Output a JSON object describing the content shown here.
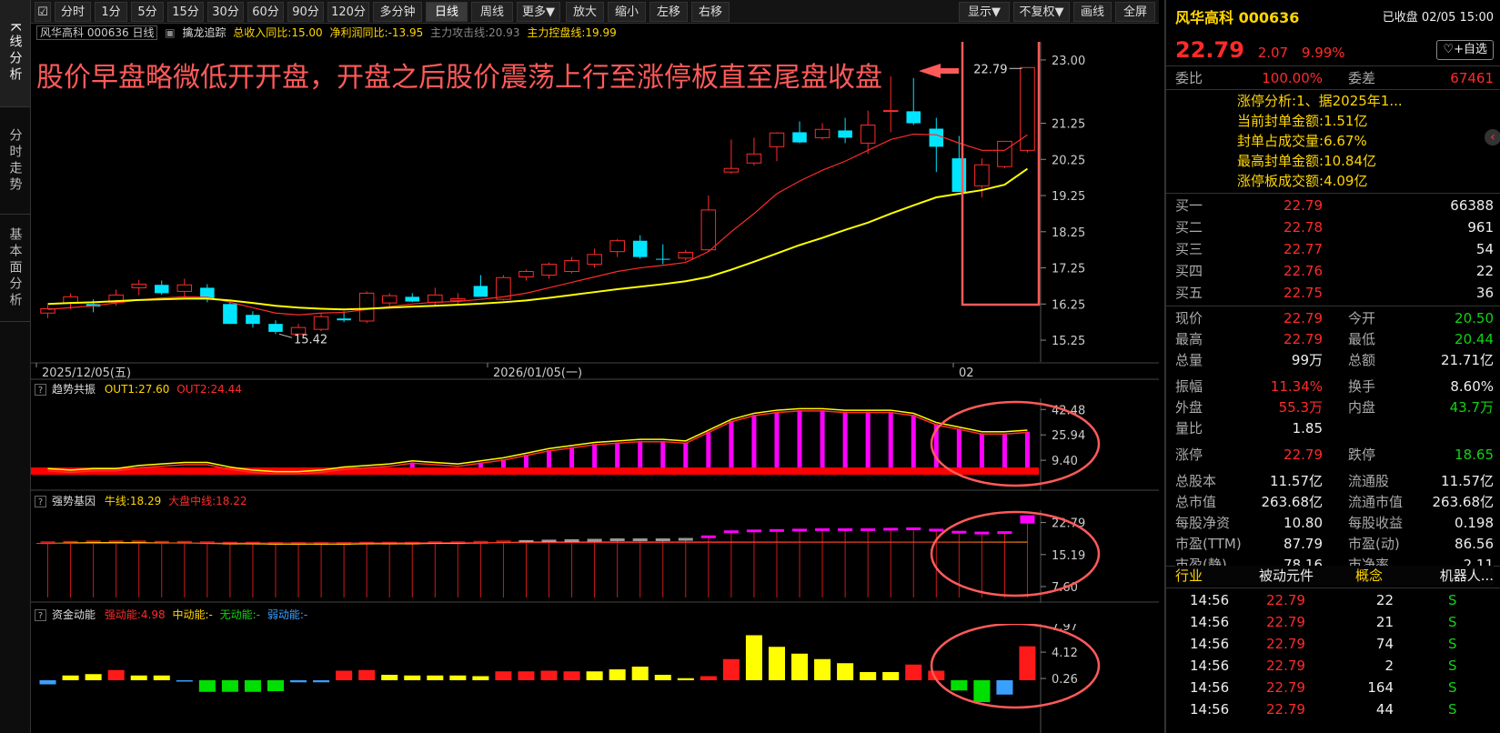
{
  "left_tabs": [
    "K线分析",
    "分时走势",
    "基本面分析"
  ],
  "toolbar": {
    "periods": [
      "分时",
      "1分",
      "5分",
      "15分",
      "30分",
      "60分",
      "90分",
      "120分",
      "多分钟",
      "日线",
      "周线",
      "更多▼"
    ],
    "active_period": "日线",
    "actions": [
      "放大",
      "缩小",
      "左移",
      "右移"
    ],
    "right": [
      "显示▼",
      "不复权▼",
      "画线",
      "全屏"
    ]
  },
  "indicator": {
    "name": "风华高科 000636 日线",
    "study": "擒龙追踪",
    "items": [
      {
        "text": "总收入同比:15.00",
        "color": "#ffd600"
      },
      {
        "text": "净利润同比:-13.95",
        "color": "#ffd600"
      },
      {
        "text": "主力攻击线:20.93",
        "color": "#888888"
      },
      {
        "text": "主力控盘线:19.99",
        "color": "#ffd600"
      }
    ]
  },
  "annotation": "股价早盘略微低开开盘，开盘之后股价震荡上行至涨停板直至尾盘收盘",
  "main_chart": {
    "y_ticks": [
      "23.00",
      "21.25",
      "20.25",
      "19.25",
      "18.25",
      "17.25",
      "16.25",
      "15.25"
    ],
    "x_labels": [
      "2025/12/05(五)",
      "2026/01/05(一)",
      "02"
    ],
    "low_label": "15.42",
    "high_label": "22.79"
  },
  "chart_data": [
    {
      "type": "candlestick",
      "title": "风华高科 000636 日线",
      "ylim": [
        15.0,
        23.3
      ],
      "ohlc": [
        [
          16.0,
          16.22,
          15.86,
          16.12
        ],
        [
          16.28,
          16.55,
          16.1,
          16.45
        ],
        [
          16.25,
          16.38,
          16.02,
          16.18
        ],
        [
          16.3,
          16.65,
          16.2,
          16.5
        ],
        [
          16.7,
          16.92,
          16.5,
          16.8
        ],
        [
          16.78,
          16.9,
          16.5,
          16.55
        ],
        [
          16.6,
          16.95,
          16.45,
          16.78
        ],
        [
          16.7,
          16.8,
          16.3,
          16.4
        ],
        [
          16.25,
          16.3,
          15.7,
          15.7
        ],
        [
          15.95,
          16.05,
          15.6,
          15.7
        ],
        [
          15.7,
          15.8,
          15.42,
          15.48
        ],
        [
          15.42,
          15.7,
          15.42,
          15.6
        ],
        [
          15.55,
          16.0,
          15.5,
          15.9
        ],
        [
          15.85,
          16.05,
          15.75,
          15.8
        ],
        [
          15.78,
          16.6,
          15.72,
          16.55
        ],
        [
          16.28,
          16.55,
          16.2,
          16.48
        ],
        [
          16.45,
          16.55,
          16.3,
          16.32
        ],
        [
          16.3,
          16.7,
          16.2,
          16.5
        ],
        [
          16.35,
          16.55,
          16.25,
          16.4
        ],
        [
          16.75,
          17.05,
          16.45,
          16.45
        ],
        [
          16.38,
          17.05,
          16.35,
          16.98
        ],
        [
          17.0,
          17.2,
          16.9,
          17.15
        ],
        [
          17.05,
          17.4,
          16.95,
          17.35
        ],
        [
          17.15,
          17.55,
          17.1,
          17.45
        ],
        [
          17.35,
          17.78,
          17.25,
          17.62
        ],
        [
          17.7,
          18.05,
          17.55,
          18.0
        ],
        [
          18.0,
          18.15,
          17.5,
          17.55
        ],
        [
          17.5,
          17.9,
          17.35,
          17.48
        ],
        [
          17.52,
          17.75,
          17.45,
          17.68
        ],
        [
          17.75,
          19.25,
          17.72,
          18.85
        ],
        [
          19.9,
          20.8,
          19.85,
          20.0
        ],
        [
          20.15,
          20.85,
          20.08,
          20.4
        ],
        [
          20.6,
          21.0,
          20.2,
          20.98
        ],
        [
          21.0,
          21.3,
          20.7,
          20.72
        ],
        [
          20.85,
          21.25,
          20.8,
          21.08
        ],
        [
          21.05,
          21.4,
          20.7,
          20.85
        ],
        [
          20.7,
          21.6,
          20.4,
          21.2
        ],
        [
          21.6,
          22.55,
          21.0,
          21.6
        ],
        [
          21.58,
          22.5,
          21.2,
          21.25
        ],
        [
          21.1,
          21.4,
          19.9,
          20.6
        ],
        [
          20.28,
          20.9,
          19.4,
          19.35
        ],
        [
          19.52,
          20.28,
          19.2,
          20.1
        ],
        [
          20.05,
          20.75,
          20.0,
          20.75
        ],
        [
          20.5,
          22.79,
          20.44,
          22.79
        ]
      ],
      "series": [
        {
          "name": "主力攻击线",
          "values": [
            16.1,
            16.15,
            16.2,
            16.28,
            16.36,
            16.42,
            16.45,
            16.44,
            16.3,
            16.15,
            16.0,
            15.95,
            16.0,
            16.02,
            16.1,
            16.18,
            16.25,
            16.3,
            16.32,
            16.38,
            16.45,
            16.55,
            16.7,
            16.85,
            17.0,
            17.15,
            17.25,
            17.32,
            17.4,
            17.7,
            18.25,
            18.75,
            19.3,
            19.65,
            19.95,
            20.2,
            20.5,
            20.8,
            20.95,
            20.93,
            20.7,
            20.5,
            20.5,
            20.93
          ]
        },
        {
          "name": "主力控盘线",
          "values": [
            16.25,
            16.28,
            16.3,
            16.33,
            16.36,
            16.38,
            16.4,
            16.4,
            16.35,
            16.28,
            16.2,
            16.15,
            16.12,
            16.1,
            16.12,
            16.15,
            16.18,
            16.2,
            16.23,
            16.26,
            16.3,
            16.35,
            16.42,
            16.5,
            16.58,
            16.66,
            16.73,
            16.8,
            16.88,
            17.0,
            17.2,
            17.42,
            17.65,
            17.88,
            18.08,
            18.3,
            18.5,
            18.75,
            18.98,
            19.2,
            19.3,
            19.4,
            19.55,
            19.99
          ]
        }
      ]
    },
    {
      "type": "bar",
      "title": "趋势共振",
      "series": [
        {
          "name": "OUT1",
          "value": 27.6
        },
        {
          "name": "OUT2",
          "value": 24.44
        }
      ],
      "values": [
        3,
        2,
        3,
        3,
        5,
        6,
        7,
        7,
        4,
        2,
        1,
        1,
        2,
        4,
        5,
        6,
        8,
        7,
        6,
        8,
        10,
        13,
        16,
        18,
        20,
        21,
        22,
        22,
        21,
        28,
        35,
        39,
        41,
        42,
        42,
        41,
        41,
        41,
        39,
        33,
        30,
        27,
        27,
        28
      ],
      "y_ticks": [
        "42.48",
        "25.94",
        "9.40"
      ]
    },
    {
      "type": "bar",
      "title": "强势基因",
      "series": [
        {
          "name": "牛线",
          "value": 18.29
        },
        {
          "name": "大盘中线",
          "value": 18.22
        }
      ],
      "values": [
        17.9,
        18.0,
        18.1,
        18.1,
        18.1,
        18.0,
        18.0,
        17.9,
        17.8,
        17.8,
        17.7,
        17.7,
        17.7,
        17.7,
        17.8,
        17.8,
        17.8,
        17.9,
        17.9,
        18.0,
        18.1,
        18.2,
        18.3,
        18.4,
        18.5,
        18.6,
        18.6,
        18.6,
        18.7,
        19.3,
        20.5,
        20.7,
        20.8,
        20.9,
        21.0,
        21.0,
        21.0,
        21.1,
        21.2,
        20.9,
        20.4,
        20.2,
        20.3,
        22.79
      ],
      "y_ticks": [
        "22.79",
        "15.19",
        "7.60"
      ]
    },
    {
      "type": "bar",
      "title": "资金动能",
      "series": [
        {
          "name": "强动能",
          "value": 4.98
        },
        {
          "name": "中动能",
          "value": "-"
        },
        {
          "name": "无动能",
          "value": "-"
        },
        {
          "name": "弱动能",
          "value": "-"
        }
      ],
      "values": [
        -0.6,
        0.7,
        0.9,
        1.5,
        0.7,
        0.7,
        -0.2,
        -1.7,
        -1.7,
        -1.7,
        -1.6,
        -0.3,
        -0.3,
        1.4,
        1.5,
        0.8,
        0.7,
        0.7,
        0.7,
        0.6,
        1.3,
        1.3,
        1.4,
        1.3,
        1.3,
        1.6,
        2.0,
        0.8,
        0.3,
        0.6,
        3.1,
        6.6,
        4.9,
        3.9,
        3.1,
        2.5,
        1.2,
        1.2,
        2.3,
        1.4,
        -1.5,
        -3.2,
        -2.1,
        4.98
      ],
      "y_ticks": [
        "7.97",
        "4.12",
        "0.26"
      ]
    }
  ],
  "panels": {
    "p1": {
      "name": "趋势共振",
      "items": [
        {
          "text": "OUT1:27.60",
          "color": "#ffd600"
        },
        {
          "text": "OUT2:24.44",
          "color": "#ff2b2b"
        }
      ]
    },
    "p2": {
      "name": "强势基因",
      "items": [
        {
          "text": "牛线:18.29",
          "color": "#ffd600"
        },
        {
          "text": "大盘中线:18.22",
          "color": "#ff2b2b"
        }
      ]
    },
    "p3": {
      "name": "资金动能",
      "items": [
        {
          "text": "强动能:4.98",
          "color": "#ff2b2b"
        },
        {
          "text": "中动能:-",
          "color": "#ffd600"
        },
        {
          "text": "无动能:-",
          "color": "#12d212"
        },
        {
          "text": "弱动能:-",
          "color": "#3aa0ff"
        }
      ]
    }
  },
  "quote": {
    "title": "风华高科 000636",
    "status": "已收盘 02/05 15:00",
    "price": "22.79",
    "change": "2.07",
    "pct": "9.99%",
    "watch_btn": "+自选",
    "weibi_label": "委比",
    "weibi": "100.00%",
    "weicha_label": "委差",
    "weicha": "67461",
    "limit_info": [
      {
        "k": "涨停分析:",
        "v": "1、据2025年1..."
      },
      {
        "k": "当前封单金额:",
        "v": "1.51亿"
      },
      {
        "k": "封单占成交量:",
        "v": "6.67%"
      },
      {
        "k": "最高封单金额:",
        "v": "10.84亿"
      },
      {
        "k": "涨停板成交额:",
        "v": "4.09亿"
      }
    ],
    "bids": [
      {
        "label": "买一",
        "price": "22.79",
        "vol": "66388"
      },
      {
        "label": "买二",
        "price": "22.78",
        "vol": "961"
      },
      {
        "label": "买三",
        "price": "22.77",
        "vol": "54"
      },
      {
        "label": "买四",
        "price": "22.76",
        "vol": "22"
      },
      {
        "label": "买五",
        "price": "22.75",
        "vol": "36"
      }
    ],
    "stats": [
      {
        "l1": "现价",
        "v1": "22.79",
        "c1": "red",
        "l2": "今开",
        "v2": "20.50",
        "c2": "green"
      },
      {
        "l1": "最高",
        "v1": "22.79",
        "c1": "red",
        "l2": "最低",
        "v2": "20.44",
        "c2": "green"
      },
      {
        "l1": "总量",
        "v1": "99万",
        "c1": "white",
        "l2": "总额",
        "v2": "21.71亿",
        "c2": "white"
      },
      {
        "l1": "振幅",
        "v1": "11.34%",
        "c1": "red",
        "l2": "换手",
        "v2": "8.60%",
        "c2": "white"
      },
      {
        "l1": "外盘",
        "v1": "55.3万",
        "c1": "red",
        "l2": "内盘",
        "v2": "43.7万",
        "c2": "green"
      },
      {
        "l1": "量比",
        "v1": "1.85",
        "c1": "white",
        "l2": "",
        "v2": "",
        "c2": "white"
      },
      {
        "l1": "涨停",
        "v1": "22.79",
        "c1": "red",
        "l2": "跌停",
        "v2": "18.65",
        "c2": "green"
      },
      {
        "l1": "总股本",
        "v1": "11.57亿",
        "c1": "white",
        "l2": "流通股",
        "v2": "11.57亿",
        "c2": "white"
      },
      {
        "l1": "总市值",
        "v1": "263.68亿",
        "c1": "white",
        "l2": "流通市值",
        "v2": "263.68亿",
        "c2": "white"
      },
      {
        "l1": "每股净资",
        "v1": "10.80",
        "c1": "white",
        "l2": "每股收益",
        "v2": "0.198",
        "c2": "white"
      },
      {
        "l1": "市盈(TTM)",
        "v1": "87.79",
        "c1": "white",
        "l2": "市盈(动)",
        "v2": "86.56",
        "c2": "white"
      },
      {
        "l1": "市盈(静)",
        "v1": "78.16",
        "c1": "white",
        "l2": "市净率",
        "v2": "2.11",
        "c2": "white"
      }
    ],
    "industry_label": "行业",
    "industry": "被动元件",
    "concept_label": "概念",
    "concept": "机器人...",
    "ticks": [
      {
        "t": "14:56",
        "p": "22.79",
        "v": "22",
        "s": "S"
      },
      {
        "t": "14:56",
        "p": "22.79",
        "v": "21",
        "s": "S"
      },
      {
        "t": "14:56",
        "p": "22.79",
        "v": "74",
        "s": "S"
      },
      {
        "t": "14:56",
        "p": "22.79",
        "v": "2",
        "s": "S"
      },
      {
        "t": "14:56",
        "p": "22.79",
        "v": "164",
        "s": "S"
      },
      {
        "t": "14:56",
        "p": "22.79",
        "v": "44",
        "s": "S"
      }
    ]
  },
  "colors": {
    "up": "#ff2b2b",
    "down": "#00e5ff",
    "ma1": "#ff2b2b",
    "ma2": "#ffff00",
    "magenta": "#ff00ff",
    "annotation": "#ff5a5a"
  }
}
